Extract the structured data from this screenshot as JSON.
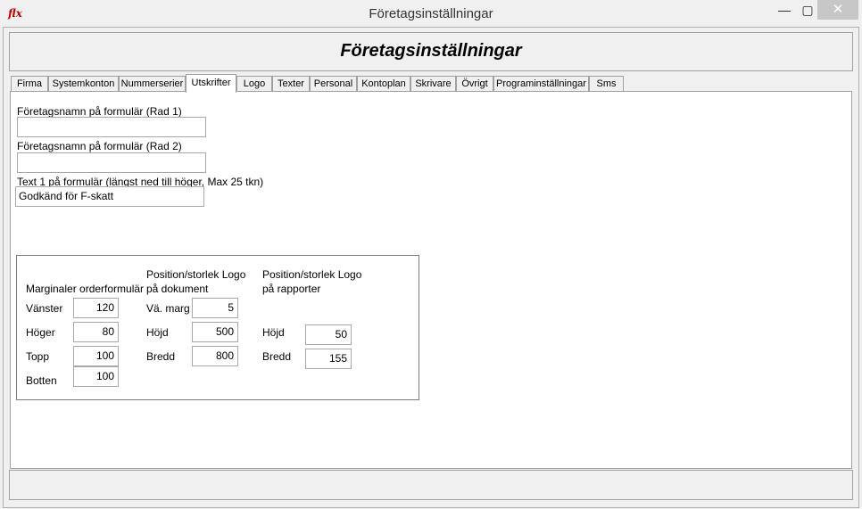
{
  "window": {
    "title": "Företagsinställningar",
    "app_icon_text": "flx",
    "minimize": "—",
    "maximize": "▢",
    "close": "✕"
  },
  "header": {
    "title": "Företagsinställningar"
  },
  "tabs": [
    {
      "label": "Firma"
    },
    {
      "label": "Systemkonton"
    },
    {
      "label": "Nummerserier"
    },
    {
      "label": "Utskrifter",
      "active": true
    },
    {
      "label": "Logo"
    },
    {
      "label": "Texter"
    },
    {
      "label": "Personal"
    },
    {
      "label": "Kontoplan"
    },
    {
      "label": "Skrivare"
    },
    {
      "label": "Övrigt"
    },
    {
      "label": "Programinställningar"
    },
    {
      "label": "Sms"
    }
  ],
  "form": {
    "rad1_label": "Företagsnamn på formulär (Rad 1)",
    "rad1_value": "",
    "rad2_label": "Företagsnamn på formulär (Rad 2)",
    "rad2_value": "",
    "text1_label": "Text 1 på formulär (längst ned till höger, Max 25 tkn)",
    "text1_value": "Godkänd för F-skatt"
  },
  "margins": {
    "heading": "Marginaler orderformulär",
    "left_label": "Vänster",
    "left_value": "120",
    "right_label": "Höger",
    "right_value": "80",
    "top_label": "Topp",
    "top_value": "100",
    "bottom_label": "Botten",
    "bottom_value": "100"
  },
  "logo_document": {
    "heading_line1": "Position/storlek  Logo",
    "heading_line2": "på dokument",
    "margin_label": "Vä. marg",
    "margin_value": "5",
    "height_label": "Höjd",
    "height_value": "500",
    "width_label": "Bredd",
    "width_value": "800"
  },
  "logo_reports": {
    "heading_line1": "Position/storlek  Logo",
    "heading_line2": "på rapporter",
    "height_label": "Höjd",
    "height_value": "50",
    "width_label": "Bredd",
    "width_value": "155"
  },
  "colors": {
    "background": "#f0f0f0",
    "content": "#ffffff",
    "close_button": "#c7c7c7",
    "app_icon": "#c00000"
  }
}
